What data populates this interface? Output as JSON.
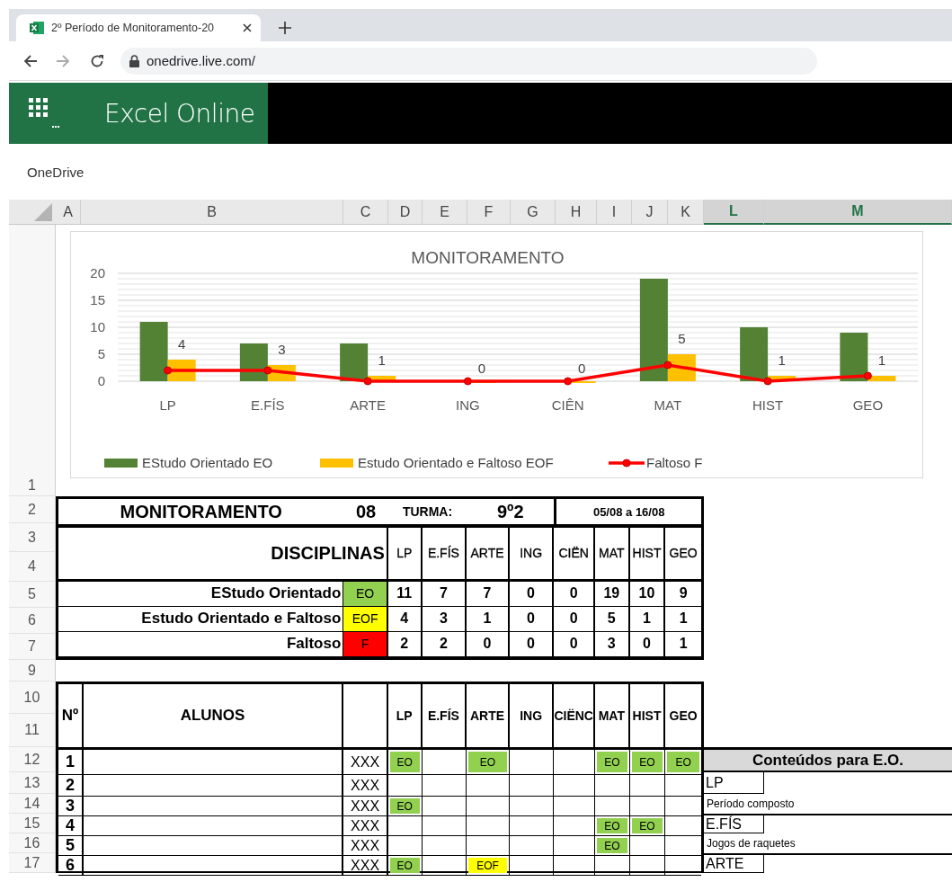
{
  "browser": {
    "tab_title": "2º Período de Monitoramento-20",
    "url": "onedrive.live.com/"
  },
  "app": {
    "name": "Excel Online",
    "breadcrumb": "OneDrive"
  },
  "columns": [
    {
      "label": "A",
      "selected": false
    },
    {
      "label": "B",
      "selected": false
    },
    {
      "label": "C",
      "selected": false
    },
    {
      "label": "D",
      "selected": false
    },
    {
      "label": "E",
      "selected": false
    },
    {
      "label": "F",
      "selected": false
    },
    {
      "label": "G",
      "selected": false
    },
    {
      "label": "H",
      "selected": false
    },
    {
      "label": "I",
      "selected": false
    },
    {
      "label": "J",
      "selected": false
    },
    {
      "label": "K",
      "selected": false
    },
    {
      "label": "L",
      "selected": true
    },
    {
      "label": "M",
      "selected": true
    }
  ],
  "rows": [
    "1",
    "2",
    "3",
    "4",
    "5",
    "6",
    "7",
    "9",
    "10",
    "11",
    "12",
    "13",
    "14",
    "15",
    "16",
    "17"
  ],
  "chart": {
    "chart_data": {
      "type": "bar",
      "title": "MONITORAMENTO",
      "categories": [
        "LP",
        "E.FÍS",
        "ARTE",
        "ING",
        "CIÊN",
        "MAT",
        "HIST",
        "GEO"
      ],
      "ylim": [
        0,
        20
      ],
      "yticks": [
        0,
        5,
        10,
        15,
        20
      ],
      "grid": true,
      "legend": true,
      "series": [
        {
          "name": "EStudo Orientado EO",
          "color": "#548235",
          "values": [
            11,
            7,
            7,
            0,
            0,
            19,
            10,
            9
          ]
        },
        {
          "name": "Estudo Orientado e Faltoso EOF",
          "color": "#ffc000",
          "values": [
            4,
            3,
            1,
            0,
            0,
            5,
            1,
            1
          ],
          "data_labels": true
        },
        {
          "name": "Faltoso F",
          "color": "#ff0000",
          "values": [
            2,
            2,
            0,
            0,
            0,
            3,
            0,
            1
          ],
          "type": "line",
          "marker": "circle"
        }
      ]
    }
  },
  "summary": {
    "title": "MONITORAMENTO",
    "number": "08",
    "class_label": "TURMA:",
    "class_name": "9º2",
    "period": "05/08 a 16/08",
    "subjects_label": "DISCIPLINAS",
    "subjects": [
      "LP",
      "E.FÍS",
      "ARTE",
      "ING",
      "CIËN",
      "MAT",
      "HIST",
      "GEO"
    ],
    "categories": [
      {
        "label": "EStudo Orientado",
        "code": "EO",
        "color": "#92d050",
        "values": [
          "11",
          "7",
          "7",
          "0",
          "0",
          "19",
          "10",
          "9"
        ]
      },
      {
        "label": "Estudo Orientado e Faltoso",
        "code": "EOF",
        "color": "#ffff00",
        "values": [
          "4",
          "3",
          "1",
          "0",
          "0",
          "5",
          "1",
          "1"
        ]
      },
      {
        "label": "Faltoso",
        "code": "F",
        "color": "#ff0000",
        "values": [
          "2",
          "2",
          "0",
          "0",
          "0",
          "3",
          "0",
          "1"
        ]
      }
    ]
  },
  "students": {
    "columns": {
      "number": "Nº",
      "name": "ALUNOS",
      "subjects": [
        "LP",
        "E.FÍS",
        "ARTE",
        "ING",
        "CIËNC",
        "MAT",
        "HIST",
        "GEO"
      ]
    },
    "rows": [
      {
        "number": "1",
        "code": "XXX",
        "marks": [
          {
            "marked": true,
            "code": "EO",
            "color": "#92d050"
          },
          {
            "marked": false
          },
          {
            "marked": true,
            "code": "EO",
            "color": "#92d050"
          },
          {
            "marked": false
          },
          {
            "marked": false
          },
          {
            "marked": true,
            "code": "EO",
            "color": "#92d050"
          },
          {
            "marked": true,
            "code": "EO",
            "color": "#92d050"
          },
          {
            "marked": true,
            "code": "EO",
            "color": "#92d050"
          }
        ]
      },
      {
        "number": "2",
        "code": "XXX",
        "marks": [
          {
            "marked": false
          },
          {
            "marked": false
          },
          {
            "marked": false
          },
          {
            "marked": false
          },
          {
            "marked": false
          },
          {
            "marked": false
          },
          {
            "marked": false
          },
          {
            "marked": false
          }
        ]
      },
      {
        "number": "3",
        "code": "XXX",
        "marks": [
          {
            "marked": true,
            "code": "EO",
            "color": "#92d050"
          },
          {
            "marked": false
          },
          {
            "marked": false
          },
          {
            "marked": false
          },
          {
            "marked": false
          },
          {
            "marked": false
          },
          {
            "marked": false
          },
          {
            "marked": false
          }
        ]
      },
      {
        "number": "4",
        "code": "XXX",
        "marks": [
          {
            "marked": false
          },
          {
            "marked": false
          },
          {
            "marked": false
          },
          {
            "marked": false
          },
          {
            "marked": false
          },
          {
            "marked": true,
            "code": "EO",
            "color": "#92d050"
          },
          {
            "marked": true,
            "code": "EO",
            "color": "#92d050"
          },
          {
            "marked": false
          }
        ]
      },
      {
        "number": "5",
        "code": "XXX",
        "marks": [
          {
            "marked": false
          },
          {
            "marked": false
          },
          {
            "marked": false
          },
          {
            "marked": false
          },
          {
            "marked": false
          },
          {
            "marked": true,
            "code": "EO",
            "color": "#92d050"
          },
          {
            "marked": false
          },
          {
            "marked": false
          }
        ]
      },
      {
        "number": "6",
        "code": "XXX",
        "marks": [
          {
            "marked": true,
            "code": "EO",
            "color": "#92d050"
          },
          {
            "marked": false
          },
          {
            "marked": true,
            "code": "EOF",
            "color": "#ffff00"
          },
          {
            "marked": false
          },
          {
            "marked": false
          },
          {
            "marked": false
          },
          {
            "marked": false
          },
          {
            "marked": false
          }
        ]
      }
    ]
  },
  "contents": {
    "title": "Conteúdos para E.O.",
    "items": [
      {
        "kind": "subject",
        "text": "LP"
      },
      {
        "kind": "topic",
        "text": "Período composto"
      },
      {
        "kind": "subject",
        "text": "E.FÍS"
      },
      {
        "kind": "topic",
        "text": "Jogos de raquetes"
      },
      {
        "kind": "subject",
        "text": "ARTE"
      }
    ]
  }
}
